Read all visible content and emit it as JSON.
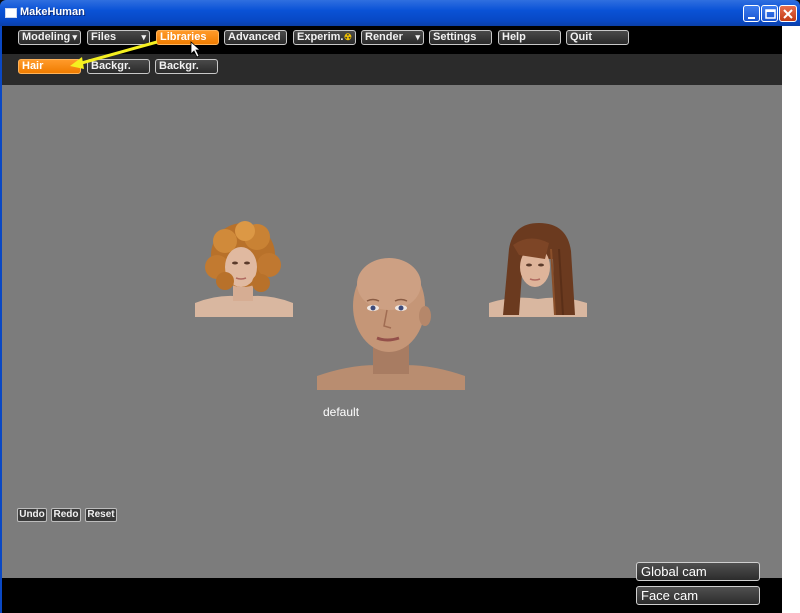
{
  "window": {
    "title": "MakeHuman"
  },
  "menu": [
    {
      "label": "Modeling",
      "arrow": "▾"
    },
    {
      "label": "Files",
      "arrow": "▾"
    },
    {
      "label": "Libraries",
      "arrow": ""
    },
    {
      "label": "Advanced",
      "arrow": ""
    },
    {
      "label": "Experim.",
      "arrow": "☢"
    },
    {
      "label": "Render",
      "arrow": "▾"
    },
    {
      "label": "Settings",
      "arrow": ""
    },
    {
      "label": "Help",
      "arrow": ""
    },
    {
      "label": "Quit",
      "arrow": ""
    }
  ],
  "submenu": [
    {
      "label": "Hair"
    },
    {
      "label": "Backgr."
    },
    {
      "label": "Backgr."
    }
  ],
  "hair_options": [
    {
      "name": "curly",
      "hair_color": "#c77b2c"
    },
    {
      "name": "default",
      "label": "default"
    },
    {
      "name": "long-straight",
      "hair_color": "#6b3a1f"
    }
  ],
  "actions": {
    "undo": "Undo",
    "redo": "Redo",
    "reset": "Reset"
  },
  "cameras": {
    "global": "Global cam",
    "face": "Face cam"
  },
  "colors": {
    "accent": "#f07c00",
    "viewport": "#7c7c7c",
    "annotation_arrow": "#f5f020"
  }
}
